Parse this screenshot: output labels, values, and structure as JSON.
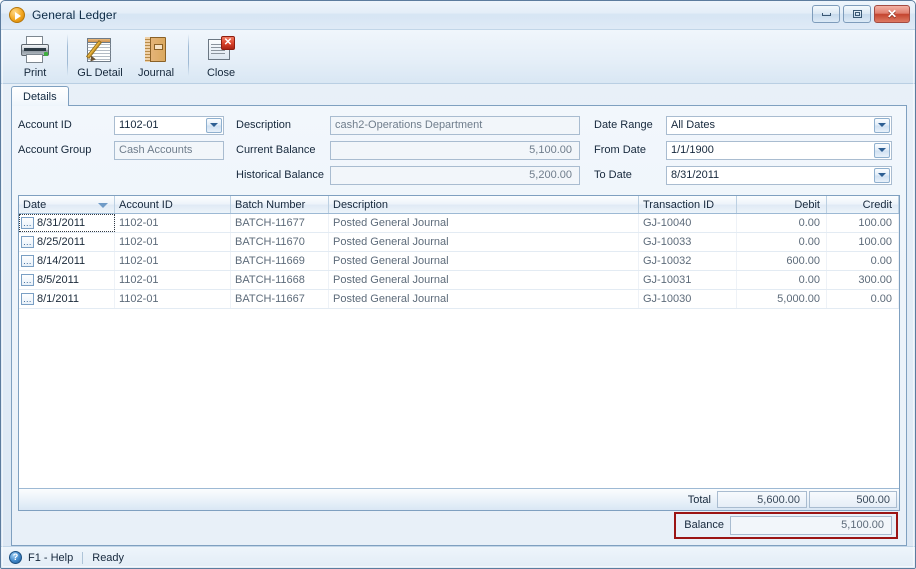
{
  "window": {
    "title": "General Ledger",
    "icon": "play-circle-icon",
    "controls": {
      "minimize": "minimize-icon",
      "restore": "restore-icon",
      "close": "✕"
    }
  },
  "toolbar": {
    "buttons": [
      {
        "label": "Print",
        "icon": "printer-icon"
      },
      {
        "label": "GL Detail",
        "icon": "ledger-pad-icon"
      },
      {
        "label": "Journal",
        "icon": "book-icon"
      },
      {
        "label": "Close",
        "icon": "close-window-icon",
        "badge": "✕"
      }
    ]
  },
  "tabs": [
    {
      "label": "Details",
      "active": true
    }
  ],
  "form": {
    "account_id": {
      "label": "Account ID",
      "value": "1102-01"
    },
    "account_group": {
      "label": "Account Group",
      "value": "Cash Accounts"
    },
    "description": {
      "label": "Description",
      "value": "cash2-Operations Department"
    },
    "current_balance": {
      "label": "Current Balance",
      "value": "5,100.00"
    },
    "historical_balance": {
      "label": "Historical Balance",
      "value": "5,200.00"
    },
    "date_range": {
      "label": "Date Range",
      "value": "All Dates"
    },
    "from_date": {
      "label": "From Date",
      "value": "1/1/1900"
    },
    "to_date": {
      "label": "To Date",
      "value": "8/31/2011"
    }
  },
  "grid": {
    "columns": [
      {
        "key": "date",
        "label": "Date",
        "align": "left",
        "sorted": true
      },
      {
        "key": "account_id",
        "label": "Account ID",
        "align": "left"
      },
      {
        "key": "batch_number",
        "label": "Batch Number",
        "align": "left"
      },
      {
        "key": "description",
        "label": "Description",
        "align": "left"
      },
      {
        "key": "transaction_id",
        "label": "Transaction ID",
        "align": "left"
      },
      {
        "key": "debit",
        "label": "Debit",
        "align": "right"
      },
      {
        "key": "credit",
        "label": "Credit",
        "align": "right"
      }
    ],
    "rows": [
      {
        "date": "8/31/2011",
        "account_id": "1102-01",
        "batch_number": "BATCH-11677",
        "description": "Posted General Journal",
        "transaction_id": "GJ-10040",
        "debit": "0.00",
        "credit": "100.00",
        "focused": true
      },
      {
        "date": "8/25/2011",
        "account_id": "1102-01",
        "batch_number": "BATCH-11670",
        "description": "Posted General Journal",
        "transaction_id": "GJ-10033",
        "debit": "0.00",
        "credit": "100.00"
      },
      {
        "date": "8/14/2011",
        "account_id": "1102-01",
        "batch_number": "BATCH-11669",
        "description": "Posted General Journal",
        "transaction_id": "GJ-10032",
        "debit": "600.00",
        "credit": "0.00"
      },
      {
        "date": "8/5/2011",
        "account_id": "1102-01",
        "batch_number": "BATCH-11668",
        "description": "Posted General Journal",
        "transaction_id": "GJ-10031",
        "debit": "0.00",
        "credit": "300.00"
      },
      {
        "date": "8/1/2011",
        "account_id": "1102-01",
        "batch_number": "BATCH-11667",
        "description": "Posted General Journal",
        "transaction_id": "GJ-10030",
        "debit": "5,000.00",
        "credit": "0.00"
      }
    ],
    "row_action_icon": "ellipsis-button",
    "total": {
      "label": "Total",
      "debit": "5,600.00",
      "credit": "500.00"
    }
  },
  "balance": {
    "label": "Balance",
    "value": "5,100.00",
    "highlight_color": "#9b1414"
  },
  "statusbar": {
    "help_icon": "?",
    "help_text": "F1 - Help",
    "status_text": "Ready"
  }
}
